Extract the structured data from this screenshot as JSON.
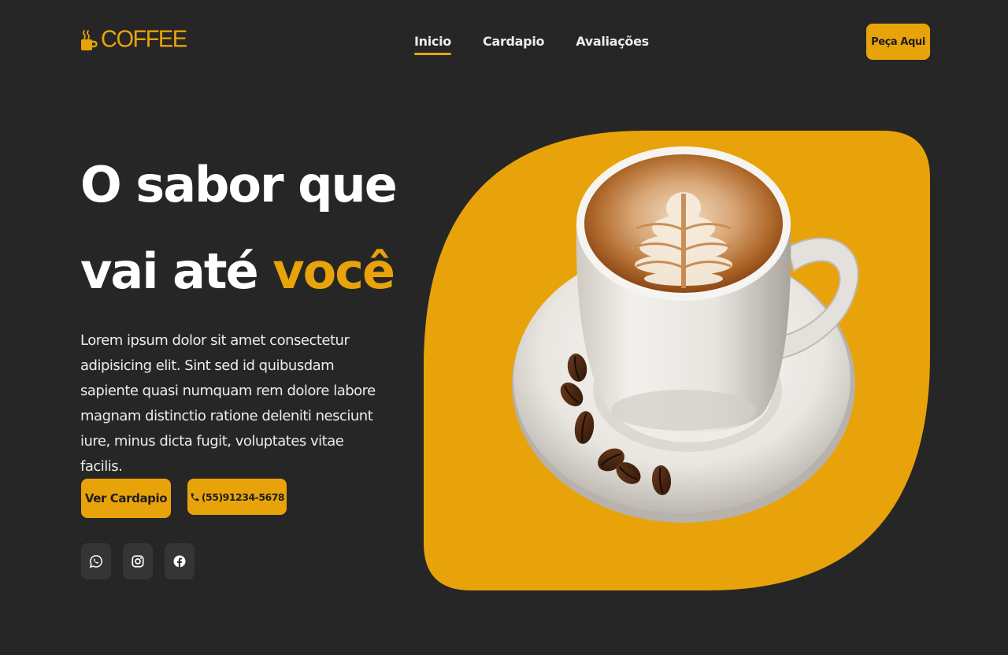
{
  "header": {
    "logo_text": "COFFEE",
    "logo_icon": "coffee-cup-icon",
    "nav": [
      {
        "label": "Inicio",
        "active": true
      },
      {
        "label": "Cardapio",
        "active": false
      },
      {
        "label": "Avaliações",
        "active": false
      }
    ],
    "order_button": "Peça Aqui"
  },
  "hero": {
    "title_line1": "O sabor que",
    "title_line2_prefix": "vai até ",
    "title_line2_highlight": "você",
    "description": "Lorem ipsum dolor sit amet consectetur adipisicing elit. Sint sed id quibusdam sapiente quasi numquam rem dolore labore magnam distinctio ratione deleniti nesciunt iure, minus dicta fugit, voluptates vitae facilis.",
    "menu_button": "Ver Cardapio",
    "phone_button": "(55)91234-5678",
    "phone_icon": "phone-icon",
    "socials": [
      "whatsapp-icon",
      "instagram-icon",
      "facebook-icon"
    ],
    "image": "cappuccino-cup-with-latte-art-and-coffee-beans"
  },
  "colors": {
    "accent": "#e9a30a",
    "background": "#262626",
    "social_bg": "#353535",
    "text": "#ffffff"
  }
}
